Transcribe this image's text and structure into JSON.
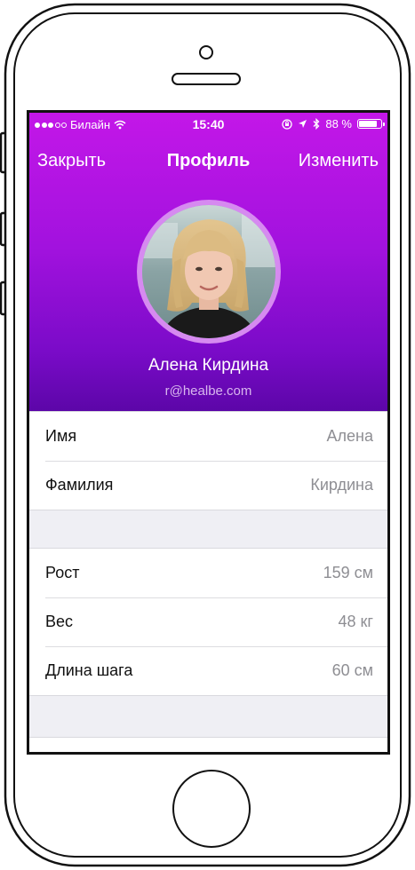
{
  "status_bar": {
    "carrier": "Билайн",
    "time": "15:40",
    "battery_percent": "88 %",
    "battery_level": 0.88
  },
  "nav": {
    "close_label": "Закрыть",
    "title": "Профиль",
    "edit_label": "Изменить"
  },
  "profile": {
    "name": "Алена Кирдина",
    "email": "r@healbe.com"
  },
  "personal": [
    {
      "label": "Имя",
      "value": "Алена"
    },
    {
      "label": "Фамилия",
      "value": "Кирдина"
    }
  ],
  "body_params": [
    {
      "label": "Рост",
      "value": "159 см"
    },
    {
      "label": "Вес",
      "value": "48 кг"
    },
    {
      "label": "Длина шага",
      "value": "60 см"
    }
  ],
  "colors": {
    "header_top": "#c317e8",
    "header_bottom": "#5c06a8",
    "value_gray": "#8e8e93",
    "background": "#efeff4"
  }
}
